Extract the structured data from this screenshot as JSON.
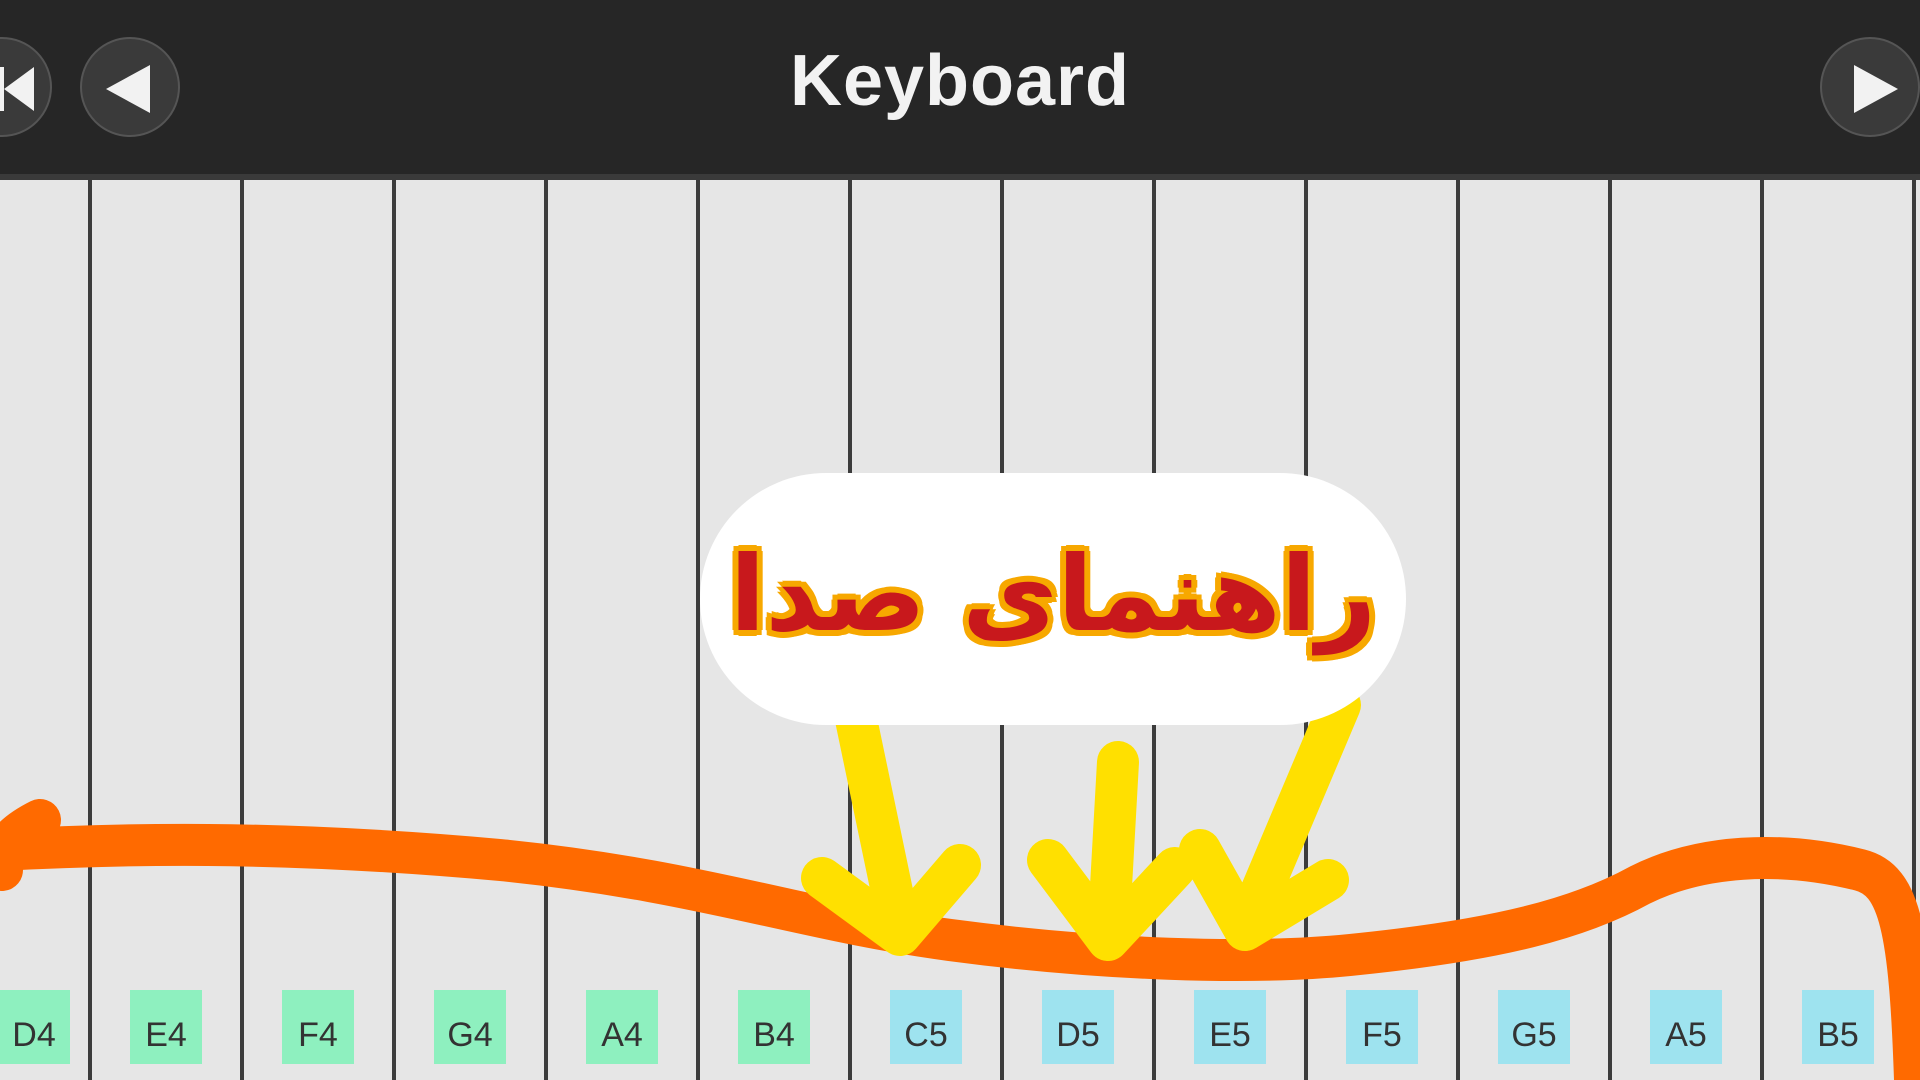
{
  "header": {
    "title": "Keyboard"
  },
  "nav": {
    "first_icon": "skip-back-icon",
    "prev_icon": "triangle-left-icon",
    "next_icon": "triangle-right-icon"
  },
  "keys": [
    {
      "note": "D4",
      "color": "#8ef0bf"
    },
    {
      "note": "E4",
      "color": "#8ef0bf"
    },
    {
      "note": "F4",
      "color": "#8ef0bf"
    },
    {
      "note": "G4",
      "color": "#8ef0bf"
    },
    {
      "note": "A4",
      "color": "#8ef0bf"
    },
    {
      "note": "B4",
      "color": "#8ef0bf"
    },
    {
      "note": "C5",
      "color": "#9ee3ef"
    },
    {
      "note": "D5",
      "color": "#9ee3ef"
    },
    {
      "note": "E5",
      "color": "#9ee3ef"
    },
    {
      "note": "F5",
      "color": "#9ee3ef"
    },
    {
      "note": "G5",
      "color": "#9ee3ef"
    },
    {
      "note": "A5",
      "color": "#9ee3ef"
    },
    {
      "note": "B5",
      "color": "#9ee3ef"
    }
  ],
  "annotation": {
    "text": "راهنمای صدا",
    "text_color": "#c8181c",
    "outline_color": "#f7a800",
    "arrow_color": "#ffe000",
    "curve_color": "#ff6a00"
  }
}
